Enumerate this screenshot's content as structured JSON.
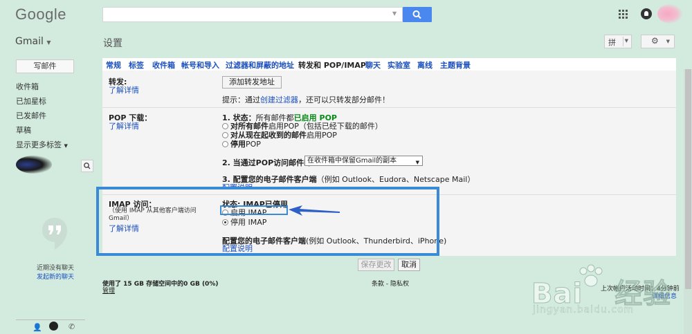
{
  "header": {
    "logo": "Google",
    "user_avatar": "avatar-blurred"
  },
  "subheader": {
    "gmail_label": "Gmail",
    "page_title": "设置",
    "lang_button": "拼",
    "gear_icon": "gear-icon"
  },
  "sidebar": {
    "compose": "写邮件",
    "items": [
      {
        "label": "收件箱"
      },
      {
        "label": "已加星标"
      },
      {
        "label": "已发邮件"
      },
      {
        "label": "草稿"
      },
      {
        "label": "显示更多标签"
      }
    ],
    "no_recent_chat": "近期没有聊天",
    "start_chat": "发起新的聊天"
  },
  "tabs": [
    {
      "label": "常规",
      "active": false
    },
    {
      "label": "标签",
      "active": false
    },
    {
      "label": "收件箱",
      "active": false
    },
    {
      "label": "帐号和导入",
      "active": false
    },
    {
      "label": "过滤器和屏蔽的地址",
      "active": false
    },
    {
      "label": "转发和 POP/IMAP",
      "active": true
    },
    {
      "label": "聊天",
      "active": false
    },
    {
      "label": "实验室",
      "active": false
    },
    {
      "label": "离线",
      "active": false
    },
    {
      "label": "主题背景",
      "active": false
    }
  ],
  "forwarding": {
    "title": "转发:",
    "learn_more": "了解详情",
    "add_button": "添加转发地址",
    "tip_prefix": "提示：通过",
    "tip_link": "创建过滤器",
    "tip_suffix": "，还可以只转发部分邮件！"
  },
  "pop": {
    "title": "POP 下载：",
    "learn_more": "了解详情",
    "status_prefix": "1. 状态：",
    "status_text": "所有邮件都",
    "status_value": "已启用 POP",
    "options": [
      {
        "bold": "对所有邮件",
        "rest": "启用POP（包括已经下载的邮件）"
      },
      {
        "bold": "对从现在起收到的邮件",
        "rest": "启用POP"
      },
      {
        "bold": "停用",
        "rest": "POP"
      }
    ],
    "when_label": "2. 当通过POP访问邮件时",
    "when_select": "在收件箱中保留Gmail的副本",
    "config_bold": "3. 配置您的电子邮件客户端",
    "config_rest": "（例如 Outlook、Eudora、Netscape Mail）",
    "config_link": "配置说明"
  },
  "imap": {
    "title": "IMAP 访问：",
    "desc": "（使用 IMAP 从其他客户端访问 Gmail）",
    "learn_more": "了解详情",
    "status": "状态: IMAP已停用",
    "enable": "启用 IMAP",
    "disable": "停用 IMAP",
    "selected": "disable",
    "config_bold": "配置您的电子邮件客户端",
    "config_rest": "(例如 Outlook、Thunderbird、iPhone)",
    "config_link": "配置说明"
  },
  "actions": {
    "save": "保存更改",
    "cancel": "取消"
  },
  "footer": {
    "storage": "使用了 15 GB 存储空间中的0 GB (0%)",
    "manage": "管理",
    "terms": "条款 - 隐私权",
    "last_activity": "上次帐户活动时间：4分钟前",
    "details": "详细信息"
  },
  "watermark": {
    "brand_en": "Bai",
    "brand_cn": "经验",
    "url": "jingyan.baidu.com"
  },
  "colors": {
    "background": "#d3ebdf",
    "link": "#1a4fbf",
    "highlight": "#3a8ad8",
    "search_button": "#4a88ef",
    "pop_enabled": "#0a8a1a"
  }
}
